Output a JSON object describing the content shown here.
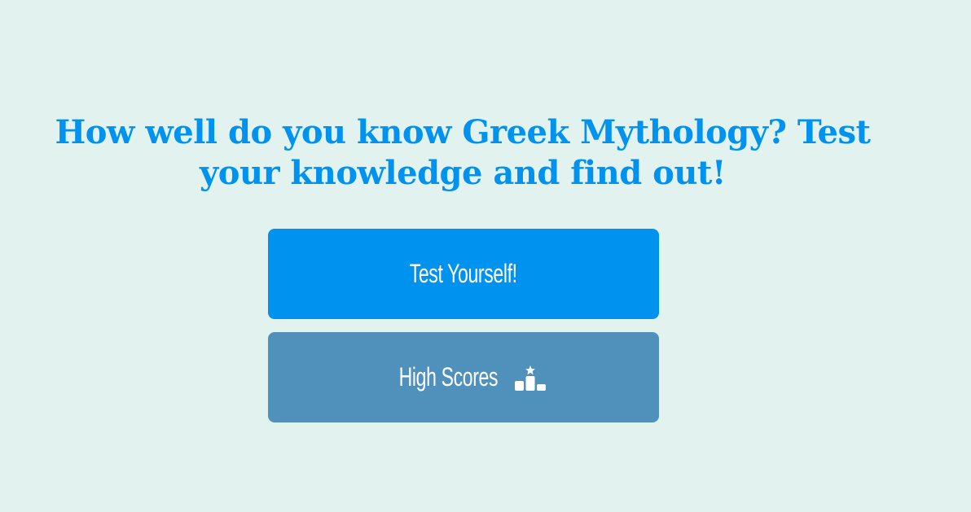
{
  "hero": {
    "heading": "How well do you know Greek Mythology? Test your knowledge and find out!"
  },
  "actions": {
    "test_label": "Test Yourself!",
    "high_scores_label": "High Scores",
    "high_scores_icon": "podium-star-icon"
  },
  "colors": {
    "background": "#e1f2ef",
    "accent": "#0092ef",
    "secondary": "#5091bb",
    "button_text": "#ffffff"
  }
}
